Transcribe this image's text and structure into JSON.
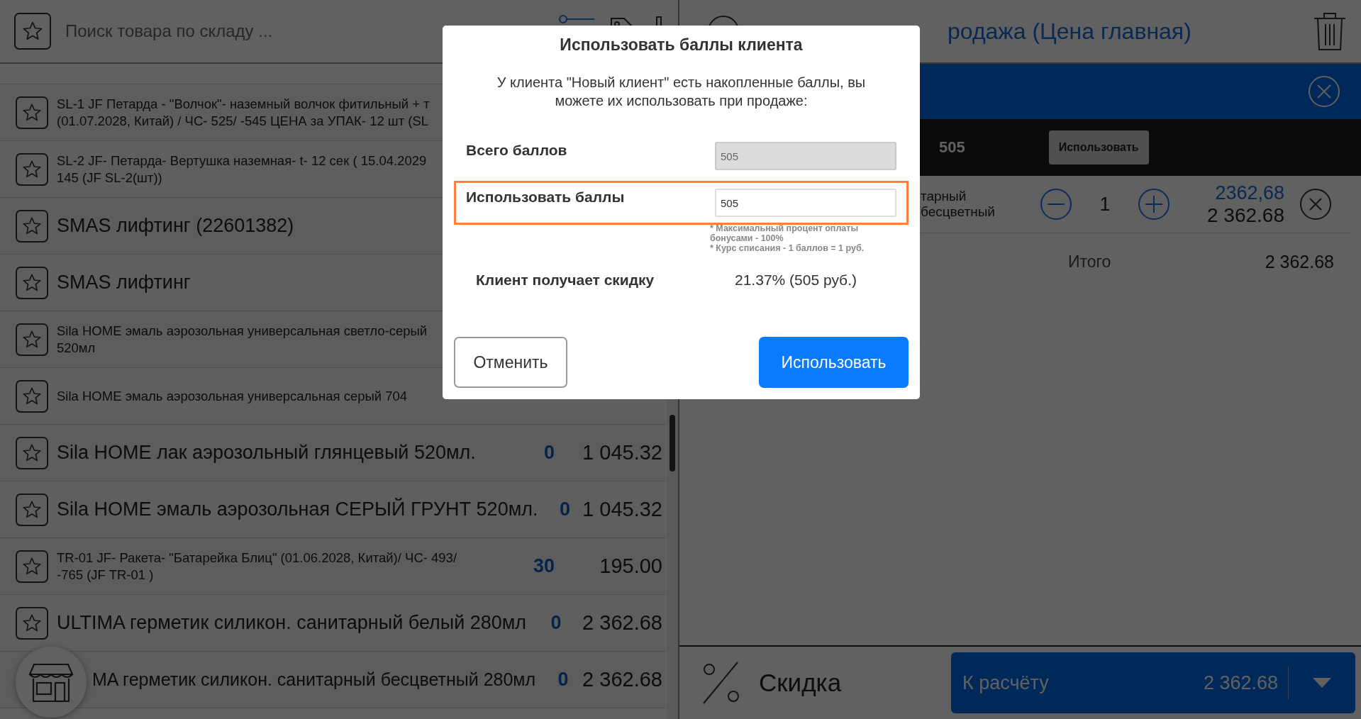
{
  "search": {
    "placeholder": "Поиск товара по складу ..."
  },
  "products": [
    {
      "kind": "compact",
      "name": "SL-1 JF Петарда - \"Волчок\"- наземный волчок фитильный + т\n(01.07.2028, Китай) / ЧС- 525/ -545 ЦЕНА за УПАК- 12 шт (SL"
    },
    {
      "kind": "compact",
      "name": "SL-2 JF- Петарда- Вертушка наземная- t- 12 сек ( 15.04.2029\n145 (JF SL-2(шт))"
    },
    {
      "kind": "plain",
      "name": "SMAS лифтинг (22601382)"
    },
    {
      "kind": "plain",
      "name": "SMAS лифтинг"
    },
    {
      "kind": "compact",
      "name": "Sila HOME эмаль аэрозольная универсальная светло-серый\n520мл"
    },
    {
      "kind": "compact",
      "name": "Sila HOME эмаль аэрозольная универсальная серый 704"
    },
    {
      "kind": "plain",
      "name": "Sila HOME лак аэрозольный глянцевый 520мл.",
      "quantity": "0",
      "price": "1 045.32"
    },
    {
      "kind": "plain",
      "name": "Sila HOME эмаль аэрозольная СЕРЫЙ ГРУНТ 520мл.",
      "quantity": "0",
      "price": "1 045.32"
    },
    {
      "kind": "compact",
      "name": "TR-01 JF- Ракета- \"Батарейка Блиц\" (01.06.2028, Китай)/ ЧС- 493/\n-765 (JF TR-01 )",
      "quantity": "30",
      "price": "195.00"
    },
    {
      "kind": "plain",
      "name": "ULTIMA герметик силикон. санитарный белый 280мл",
      "quantity": "0",
      "price": "2 362.68"
    },
    {
      "kind": "covered",
      "name": "MA герметик силикон. санитарный бесцветный 280мл",
      "quantity": "0",
      "price": "2 362.68"
    }
  ],
  "sale": {
    "title": "родажа (Цена главная)",
    "bonus_bar": {
      "points": "505",
      "button": "Использовать"
    },
    "items": [
      {
        "name": "тарный бесцветный",
        "quantity": "1",
        "unit_price": "2362,68",
        "total": "2 362.68"
      }
    ],
    "total_label": "Итого",
    "total": "2 362.68"
  },
  "footer": {
    "discount": "Скидка",
    "checkout_label": "К расчёту",
    "checkout_total": "2 362.68"
  },
  "dialog": {
    "title": "Использовать баллы клиента",
    "message": "У клиента \"Новый клиент\" есть накопленные баллы, вы можете их использовать при продаже:",
    "fields": [
      {
        "label": "Всего баллов",
        "value": "505",
        "disabled": true,
        "highlighted": false
      },
      {
        "label": "Использовать баллы",
        "value": "505",
        "disabled": false,
        "highlighted": true,
        "notes": [
          "* Максимальный процент оплаты бонусами - 100%",
          "* Курс списания - 1 баллов = 1 руб."
        ]
      }
    ],
    "discount_label": "Клиент получает скидку",
    "discount_value": "21.37% (505 руб.)",
    "buttons": [
      {
        "label": "Отменить",
        "kind": "secondary"
      },
      {
        "label": "Использовать",
        "kind": "primary"
      }
    ]
  }
}
